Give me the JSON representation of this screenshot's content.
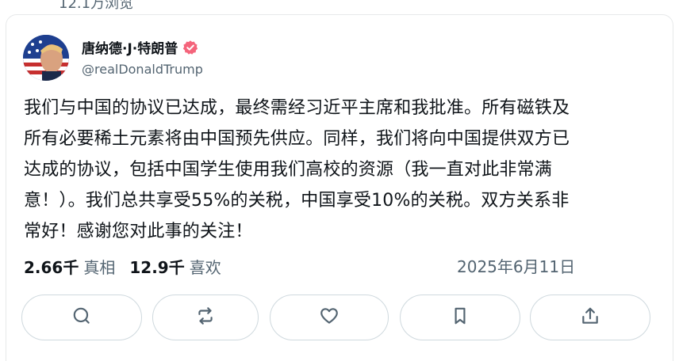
{
  "top_partial_text": "12.1万浏览",
  "author": {
    "display_name": "唐纳德·J·特朗普",
    "handle": "@realDonaldTrump",
    "verified_icon": "verified-badge-icon",
    "badge_color": "#f4647b"
  },
  "post": {
    "lines": [
      "我们与中国的协议已达成，最终需经习近平主席和我批准。所有磁铁及",
      "所有必要稀土元素将由中国预先供应。同样，我们将向中国提供双方已",
      "达成的协议，包括中国学生使用我们高校的资源（我一直对此非常满",
      "意！）。我们总共享受55%的关税，中国享受10%的关税。双方关系非",
      "常好！感谢您对此事的关注！"
    ],
    "stats": {
      "truths_count": "2.66千",
      "truths_label": "真相",
      "likes_count": "12.9千",
      "likes_label": "喜欢"
    },
    "date": "2025年6月11日"
  },
  "actions": [
    {
      "name": "reply",
      "icon": "reply-icon"
    },
    {
      "name": "retruth",
      "icon": "repost-icon"
    },
    {
      "name": "like",
      "icon": "heart-icon"
    },
    {
      "name": "bookmark",
      "icon": "bookmark-icon"
    },
    {
      "name": "share",
      "icon": "share-icon"
    }
  ],
  "colors": {
    "text": "#0f1419",
    "muted": "#536471",
    "border": "#cfd9de"
  }
}
